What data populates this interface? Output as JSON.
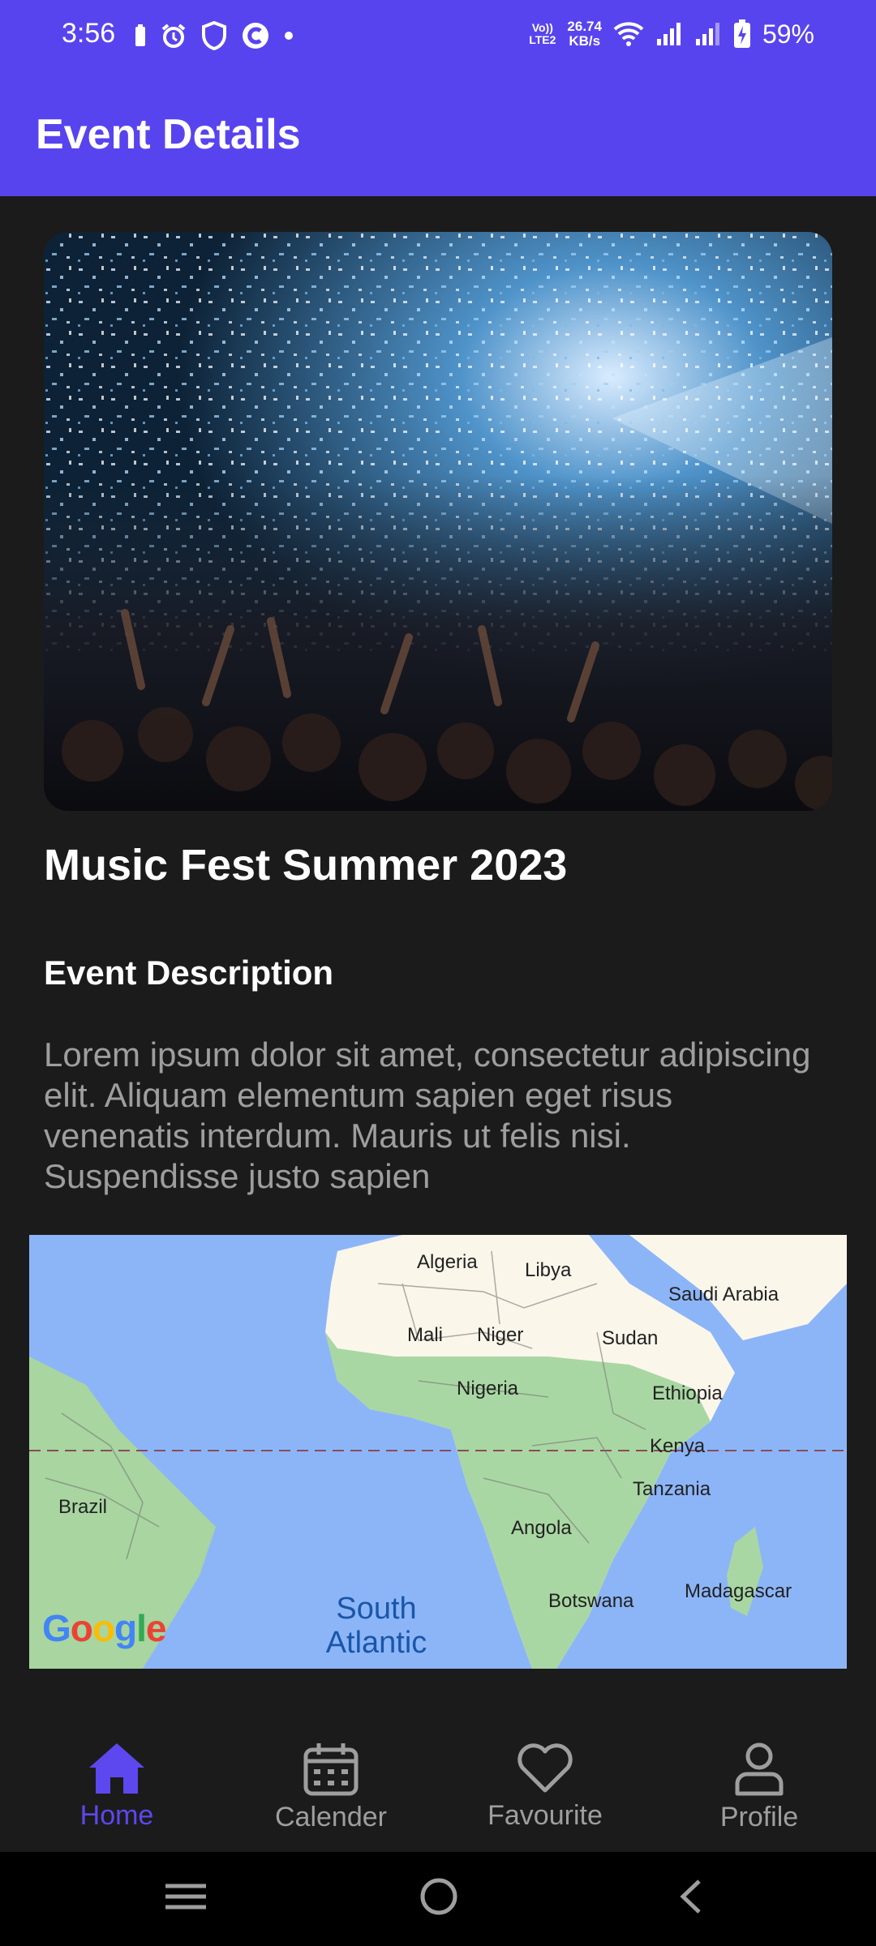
{
  "status_bar": {
    "time": "3:56",
    "net_speed_value": "26.74",
    "net_speed_unit": "KB/s",
    "volte_top": "Vo))",
    "volte_bottom": "LTE2",
    "battery_percent": "59%",
    "left_icons": [
      "battery-saver-icon",
      "alarm-icon",
      "shield-icon",
      "app-c-icon",
      "dot-icon"
    ],
    "right_icons": [
      "wifi-icon",
      "signal-icon",
      "signal-icon",
      "battery-charging-icon"
    ]
  },
  "app_bar": {
    "title": "Event Details"
  },
  "event": {
    "image_icon": "concert-photo",
    "title": "Music Fest Summer 2023",
    "description_heading": "Event Description",
    "description": "Lorem ipsum dolor sit amet, consectetur adipiscing elit. Aliquam elementum sapien eget risus venenatis interdum. Mauris ut felis nisi. Suspendisse justo sapien"
  },
  "map": {
    "labels": {
      "algeria": "Algeria",
      "libya": "Libya",
      "saudi_arabia": "Saudi Arabia",
      "mali": "Mali",
      "niger": "Niger",
      "sudan": "Sudan",
      "nigeria": "Nigeria",
      "ethiopia": "Ethiopia",
      "kenya": "Kenya",
      "brazil": "Brazil",
      "tanzania": "Tanzania",
      "angola": "Angola",
      "madagascar": "Madagascar",
      "botswana": "Botswana",
      "ocean_line1": "South",
      "ocean_line2": "Atlantic"
    },
    "logo": "Google"
  },
  "bottom_nav": {
    "items": [
      {
        "label": "Home",
        "icon": "home-icon",
        "active": true
      },
      {
        "label": "Calender",
        "icon": "calendar-icon",
        "active": false
      },
      {
        "label": "Favourite",
        "icon": "heart-icon",
        "active": false
      },
      {
        "label": "Profile",
        "icon": "profile-icon",
        "active": false
      }
    ]
  },
  "system_nav": {
    "buttons": [
      "recents-icon",
      "home-circle-icon",
      "back-icon"
    ]
  },
  "colors": {
    "primary": "#5844ee",
    "background": "#1b1b1b",
    "text_secondary": "#9e9e9e",
    "active_nav": "#5c48ee"
  }
}
